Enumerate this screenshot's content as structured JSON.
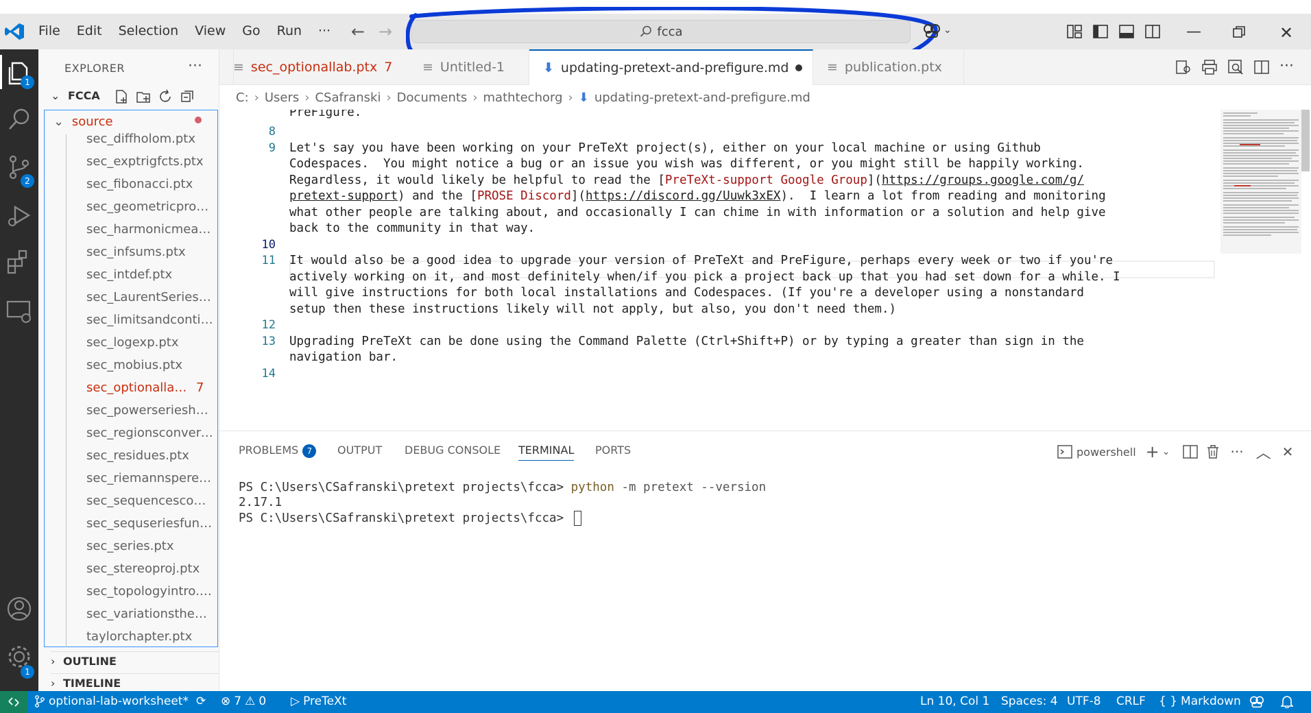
{
  "menu": {
    "file": "File",
    "edit": "Edit",
    "selection": "Selection",
    "view": "View",
    "go": "Go",
    "run": "Run",
    "more": "···"
  },
  "command_center": {
    "text": "fcca"
  },
  "explorer": {
    "title": "EXPLORER",
    "more": "···",
    "root_folder": "FCCA",
    "source_folder": "source",
    "files": [
      "sec_diffholom.ptx",
      "sec_exptrigfcts.ptx",
      "sec_fibonacci.ptx",
      "sec_geometricprops...",
      "sec_harmonicmeanv...",
      "sec_infsums.ptx",
      "sec_intdef.ptx",
      "sec_LaurentSeries.ptx",
      "sec_limitsandcontin...",
      "sec_logexp.ptx",
      "sec_mobius.ptx",
      "sec_optionallab...",
      "sec_powerseriesholo...",
      "sec_regionsconverg...",
      "sec_residues.ptx",
      "sec_riemannspere.ptx",
      "sec_sequencescomp...",
      "sec_sequseriesfuncti...",
      "sec_series.ptx",
      "sec_stereoproj.ptx",
      "sec_topologyintro.ptx",
      "sec_variationstheme...",
      "taylorchapter.ptx"
    ],
    "error_file_count": "7",
    "outline": "OUTLINE",
    "timeline": "TIMELINE"
  },
  "activity": {
    "explorer_badge": "1",
    "scm_badge": "2",
    "settings_badge": "1"
  },
  "tabs": [
    {
      "label": "sec_optionallab.ptx",
      "count": "7"
    },
    {
      "label": "Untitled-1"
    },
    {
      "label": "updating-pretext-and-prefigure.md"
    },
    {
      "label": "publication.ptx"
    }
  ],
  "breadcrumb": [
    "C:",
    "Users",
    "CSafranski",
    "Documents",
    "mathtechorg",
    "updating-pretext-and-prefigure.md"
  ],
  "editor": {
    "line_numbers": [
      "8",
      "9",
      "10",
      "11",
      "12",
      "13",
      "14"
    ],
    "lines": {
      "l0": "PreFigure.",
      "l9a": "Let's say you have been working on your PreTeXt project(s), either on your local machine or using Github",
      "l9b": "Codespaces.  You might notice a bug or an issue you wish was different, or you might still be happily working.",
      "l9c_pre": "Regardless, it would likely be helpful to read the [",
      "l9c_red": "PreTeXt-support Google Group",
      "l9c_mid": "](",
      "l9c_url": "https://groups.google.com/g/",
      "l9d_url": "pretext-support",
      "l9d_mid": ") and the [",
      "l9d_red": "PROSE Discord",
      "l9d_mid2": "](",
      "l9d_url2": "https://discord.gg/Uuwk3xEX",
      "l9d_post": ").  I learn a lot from reading and monitoring",
      "l9e": "what other people are talking about, and occasionally I can chime in with information or a solution and help give",
      "l9f": "back to the community in that way.",
      "l11a": "It would also be a good idea to upgrade your version of PreTeXt and PreFigure, perhaps every week or two if you're",
      "l11b": "actively working on it, and most definitely when/if you pick a project back up that you had set down for a while. I",
      "l11c": "will give instructions for both local installations and Codespaces. (If you're a developer using a nonstandard",
      "l11d": "setup then these instructions likely will not apply, but also, you don't need them.)",
      "l13a": "Upgrading PreTeXt can be done using the Command Palette (Ctrl+Shift+P) or by typing a greater than sign in the",
      "l13b": "navigation bar."
    }
  },
  "panel": {
    "tabs": {
      "problems": "PROBLEMS",
      "problems_count": "7",
      "output": "OUTPUT",
      "debug": "DEBUG CONSOLE",
      "terminal": "TERMINAL",
      "ports": "PORTS"
    },
    "shell": "powershell",
    "terminal": {
      "prompt1": "PS C:\\Users\\CSafranski\\pretext projects\\fcca> ",
      "cmd": "python",
      "args": " -m pretext --version",
      "output": "2.17.1",
      "prompt2": "PS C:\\Users\\CSafranski\\pretext projects\\fcca> "
    }
  },
  "status": {
    "branch": "optional-lab-worksheet*",
    "errors": "7",
    "warnings": "0",
    "pretext": "PreTeXt",
    "position": "Ln 10, Col 1",
    "spaces": "Spaces: 4",
    "encoding": "UTF-8",
    "eol": "CRLF",
    "language": "Markdown"
  },
  "colors": {
    "accent": "#007acc",
    "error": "#c72e0f",
    "annotation": "#0b3bd6"
  }
}
